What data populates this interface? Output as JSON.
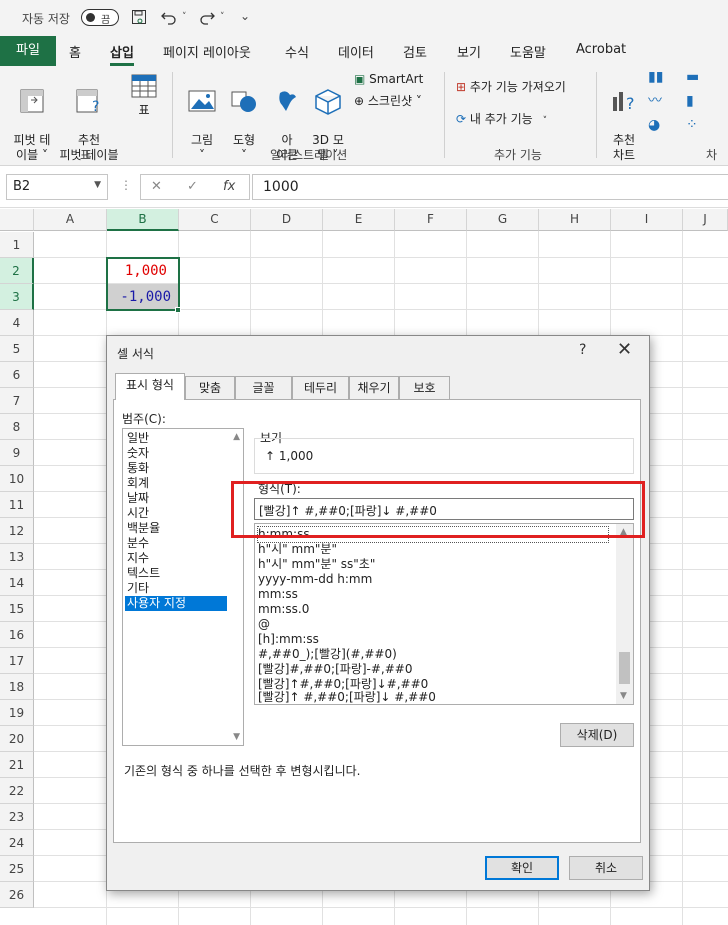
{
  "titlebar": {
    "autosave_label": "자동 저장",
    "autosave_state": "끔"
  },
  "ribbon_tabs": [
    "파일",
    "홈",
    "삽입",
    "페이지 레이아웃",
    "수식",
    "데이터",
    "검토",
    "보기",
    "도움말",
    "Acrobat"
  ],
  "ribbon": {
    "pivot_table": "피벗 테\n이블 ˅",
    "recommended_pivot": "추천\n피벗 테이블",
    "table": "표",
    "tables_group": "표",
    "pictures": "그림\n˅",
    "shapes": "도형\n˅",
    "icons": "아\n이콘",
    "models_3d": "3D 모\n델 ˅",
    "smartart": "SmartArt",
    "screenshot": "스크린샷 ˅",
    "illustrations_group": "일러스트레이션",
    "get_addins": "추가 기능 가져오기",
    "my_addins": "내 추가 기능",
    "addins_group": "추가 기능",
    "recommended_charts": "추천\n차트",
    "charts_group": "차트"
  },
  "formula_bar": {
    "name_box": "B2",
    "value": "1000",
    "fx": "fx"
  },
  "grid": {
    "columns": [
      "A",
      "B",
      "C",
      "D",
      "E",
      "F",
      "G",
      "H",
      "I",
      "J"
    ],
    "rows": [
      "1",
      "2",
      "3",
      "4",
      "5",
      "6",
      "7",
      "8",
      "9",
      "10",
      "11",
      "12",
      "13",
      "14",
      "15",
      "16",
      "17",
      "18",
      "19",
      "20",
      "21",
      "22",
      "23",
      "24",
      "25",
      "26"
    ],
    "b2": "1,000",
    "b3": "-1,000"
  },
  "dialog": {
    "title": "셀 서식",
    "help": "?",
    "tabs": [
      "표시 형식",
      "맞춤",
      "글꼴",
      "테두리",
      "채우기",
      "보호"
    ],
    "category_label": "범주(C):",
    "categories": [
      "일반",
      "숫자",
      "통화",
      "회계",
      "날짜",
      "시간",
      "백분율",
      "분수",
      "지수",
      "텍스트",
      "기타",
      "사용자 지정"
    ],
    "sample_label": "보기",
    "sample_value": "↑ 1,000",
    "type_label": "형식(T):",
    "type_value": "[빨강]↑ #,##0;[파랑]↓ #,##0",
    "formats": [
      "h:mm:ss",
      "h\"시\" mm\"분\"",
      "h\"시\" mm\"분\" ss\"초\"",
      "yyyy-mm-dd h:mm",
      "mm:ss",
      "mm:ss.0",
      "@",
      "[h]:mm:ss",
      "#,##0_);[빨강](#,##0)",
      "[빨강]#,##0;[파랑]-#,##0",
      "[빨강]↑#,##0;[파랑]↓#,##0",
      "[빨강]↑ #,##0;[파랑]↓ #,##0"
    ],
    "delete_button": "삭제(D)",
    "description": "기존의 형식 중 하나를 선택한 후 변형시킵니다.",
    "ok_button": "확인",
    "cancel_button": "취소"
  },
  "colors": {
    "excel_green": "#1e7145",
    "selection_blue": "#0078d7",
    "highlight_red": "#e02020",
    "positive_red": "#e00000",
    "negative_blue": "#1a1aa8"
  }
}
